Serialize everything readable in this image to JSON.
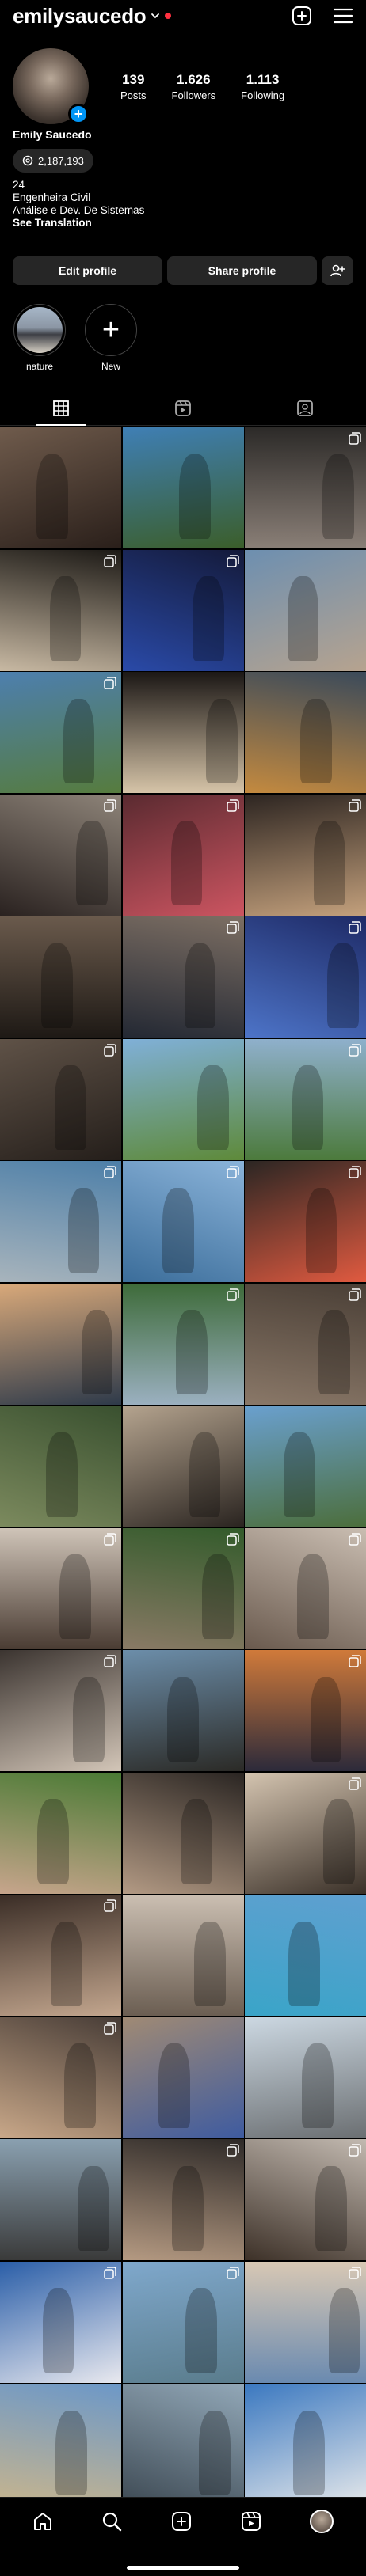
{
  "header": {
    "username": "emilysaucedo"
  },
  "profile": {
    "stats": [
      {
        "value": "139",
        "label": "Posts"
      },
      {
        "value": "1.626",
        "label": "Followers"
      },
      {
        "value": "1.113",
        "label": "Following"
      }
    ],
    "name": "Emily Saucedo",
    "threads_count": "2,187,193",
    "bio": [
      "24",
      "Engenheira Civil",
      "Análise e Dev. De Sistemas"
    ],
    "translation_link": "See Translation"
  },
  "actions": {
    "edit": "Edit profile",
    "share": "Share profile"
  },
  "highlights": [
    {
      "label": "nature"
    },
    {
      "label": "New"
    }
  ],
  "posts": [
    {
      "a": "#6f5b4c",
      "b": "#2a1f1a",
      "badge": false
    },
    {
      "a": "#3f7fb5",
      "b": "#3b5e2a",
      "badge": false
    },
    {
      "a": "#2c2a28",
      "b": "#8a7f77",
      "badge": true
    },
    {
      "a": "#1d1a16",
      "b": "#c8b9a3",
      "badge": true
    },
    {
      "a": "#141a3a",
      "b": "#2a4aa8",
      "badge": true
    },
    {
      "a": "#6d8fb0",
      "b": "#b6a38f",
      "badge": false
    },
    {
      "a": "#4d7fae",
      "b": "#567c3e",
      "badge": true
    },
    {
      "a": "#1b1715",
      "b": "#d6c4a8",
      "badge": false
    },
    {
      "a": "#3b4a5a",
      "b": "#c48a3f",
      "badge": false
    },
    {
      "a": "#8e8479",
      "b": "#2a2220",
      "badge": true
    },
    {
      "a": "#5a2a30",
      "b": "#cc5561",
      "badge": true
    },
    {
      "a": "#2d2521",
      "b": "#c3a07c",
      "badge": true
    },
    {
      "a": "#6a5a4c",
      "b": "#1e1915",
      "badge": false
    },
    {
      "a": "#7c6e63",
      "b": "#232833",
      "badge": true
    },
    {
      "a": "#1e2a66",
      "b": "#4d74c8",
      "badge": true
    },
    {
      "a": "#5f5247",
      "b": "#241e1a",
      "badge": true
    },
    {
      "a": "#80b0d8",
      "b": "#5e8a3a",
      "badge": false
    },
    {
      "a": "#8fb0cc",
      "b": "#4c7a3c",
      "badge": true
    },
    {
      "a": "#4d7fa8",
      "b": "#a8b4bc",
      "badge": true
    },
    {
      "a": "#8ab3d9",
      "b": "#3b6d9a",
      "badge": true
    },
    {
      "a": "#2b2623",
      "b": "#e05a40",
      "badge": true
    },
    {
      "a": "#d9a97a",
      "b": "#2e3a4a",
      "badge": false
    },
    {
      "a": "#3e6b3a",
      "b": "#9bb0c0",
      "badge": true
    },
    {
      "a": "#4a3f36",
      "b": "#8a7868",
      "badge": true
    },
    {
      "a": "#39502f",
      "b": "#7c8a5e",
      "badge": false
    },
    {
      "a": "#b5a48f",
      "b": "#2a2420",
      "badge": false
    },
    {
      "a": "#6aa0cf",
      "b": "#4c6e3c",
      "badge": false
    },
    {
      "a": "#cfc4b8",
      "b": "#4a3c33",
      "badge": true
    },
    {
      "a": "#335b2b",
      "b": "#8a7a66",
      "badge": true
    },
    {
      "a": "#c9bdb1",
      "b": "#6a5a4e",
      "badge": true
    },
    {
      "a": "#3b3430",
      "b": "#d3c6b8",
      "badge": true
    },
    {
      "a": "#6c8eaa",
      "b": "#2b2a26",
      "badge": false
    },
    {
      "a": "#d07a3a",
      "b": "#2c2a3a",
      "badge": true
    },
    {
      "a": "#4a7a34",
      "b": "#c7a58c",
      "badge": false
    },
    {
      "a": "#2a2522",
      "b": "#b39a84",
      "badge": false
    },
    {
      "a": "#d4c4b0",
      "b": "#3a3028",
      "badge": true
    },
    {
      "a": "#3a2d26",
      "b": "#c3a68e",
      "badge": true
    },
    {
      "a": "#cbbfb2",
      "b": "#6b5e52",
      "badge": false
    },
    {
      "a": "#5fa0d0",
      "b": "#3aa4c8",
      "badge": false
    },
    {
      "a": "#473c36",
      "b": "#c9a889",
      "badge": true
    },
    {
      "a": "#a08a74",
      "b": "#3e5ba0",
      "badge": false
    },
    {
      "a": "#ccd8e2",
      "b": "#6b6f72",
      "badge": false
    },
    {
      "a": "#8aa0b0",
      "b": "#3a3a3a",
      "badge": false
    },
    {
      "a": "#2e2a28",
      "b": "#b59a82",
      "badge": true
    },
    {
      "a": "#c2b9b0",
      "b": "#3d3128",
      "badge": true
    },
    {
      "a": "#2a5ea8",
      "b": "#e9e9ef",
      "badge": true
    },
    {
      "a": "#7fa8cc",
      "b": "#5a7c8c",
      "badge": true
    },
    {
      "a": "#d8c8b4",
      "b": "#6a8ab0",
      "badge": true
    },
    {
      "a": "#6c98c8",
      "b": "#c6b48e",
      "badge": false
    },
    {
      "a": "#92a8b8",
      "b": "#3e4a54",
      "badge": false
    },
    {
      "a": "#3a78c0",
      "b": "#e4e7ea",
      "badge": false
    }
  ]
}
